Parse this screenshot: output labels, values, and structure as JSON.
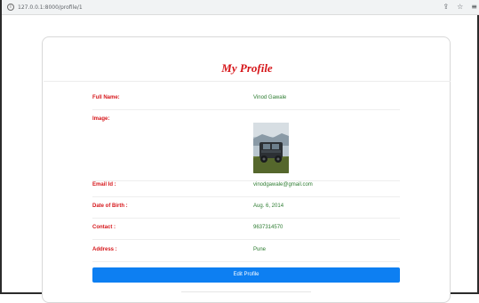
{
  "browser": {
    "url": "127.0.0.1:8000/profile/1",
    "info_icon": "info-icon",
    "share_icon": "share-icon",
    "bookmark_icon": "star-icon",
    "extensions_icon": "menu-icon"
  },
  "profile": {
    "title": "My Profile",
    "fields": {
      "full_name": {
        "label": "Full Name:",
        "value": "Vinod Gawale"
      },
      "image": {
        "label": "Image:"
      },
      "email": {
        "label": "Email Id :",
        "value": "vinodgawale@gmail.com"
      },
      "dob": {
        "label": "Date of Birth :",
        "value": "Aug. 6, 2014"
      },
      "contact": {
        "label": "Contact :",
        "value": "9637314570"
      },
      "address": {
        "label": "Address :",
        "value": "Pune"
      }
    },
    "edit_button": "Edit Profile"
  },
  "colors": {
    "label": "#d6161a",
    "value": "#2e7d32",
    "button": "#0d7ff2"
  }
}
